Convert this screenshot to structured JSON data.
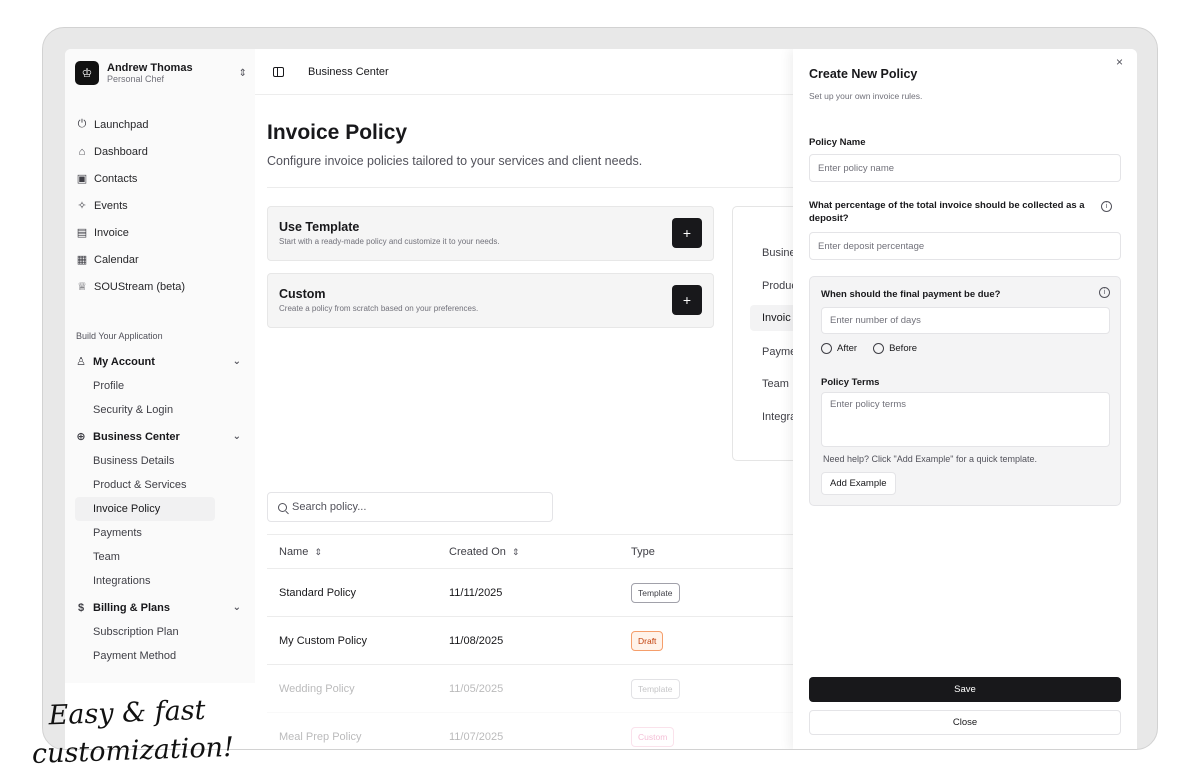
{
  "profile": {
    "name": "Andrew Thomas",
    "role": "Personal Chef",
    "avatar_icon": "chef-hat-icon"
  },
  "nav": [
    {
      "label": "Launchpad",
      "icon": "⏻"
    },
    {
      "label": "Dashboard",
      "icon": "⌂"
    },
    {
      "label": "Contacts",
      "icon": "▣"
    },
    {
      "label": "Events",
      "icon": "✧"
    },
    {
      "label": "Invoice",
      "icon": "▤"
    },
    {
      "label": "Calendar",
      "icon": "▦"
    },
    {
      "label": "SOUStream (beta)",
      "icon": "♕"
    }
  ],
  "section_label": "Build Your Application",
  "groups": {
    "my_account": {
      "label": "My Account",
      "items": [
        "Profile",
        "Security & Login"
      ]
    },
    "business_center": {
      "label": "Business Center",
      "items": [
        "Business Details",
        "Product & Services",
        "Invoice Policy",
        "Payments",
        "Team",
        "Integrations"
      ]
    },
    "billing": {
      "label": "Billing & Plans",
      "items": [
        "Subscription Plan",
        "Payment Method"
      ]
    }
  },
  "topbar": {
    "breadcrumb": "Business Center"
  },
  "page": {
    "title": "Invoice Policy",
    "subtitle": "Configure invoice policies tailored to your services and client needs."
  },
  "cards": {
    "template": {
      "title": "Use Template",
      "desc": "Start with a ready-made policy and customize it to your needs.",
      "btn": "+"
    },
    "custom": {
      "title": "Custom",
      "desc": "Create a policy from scratch based on your preferences.",
      "btn": "+"
    }
  },
  "tabs": [
    "Busine",
    "Produc",
    "Invoic",
    "Payme",
    "Team",
    "Integra"
  ],
  "search": {
    "placeholder": "Search policy..."
  },
  "table": {
    "headers": {
      "name": "Name",
      "created": "Created On",
      "type": "Type"
    },
    "rows": [
      {
        "name": "Standard Policy",
        "created": "11/11/2025",
        "type": "Template"
      },
      {
        "name": "My Custom Policy",
        "created": "11/08/2025",
        "type": "Draft"
      },
      {
        "name": "Wedding Policy",
        "created": "11/05/2025",
        "type": "Template"
      },
      {
        "name": "Meal Prep Policy",
        "created": "11/07/2025",
        "type": "Custom"
      }
    ]
  },
  "drawer": {
    "title": "Create New Policy",
    "subtitle": "Set up your own invoice rules.",
    "close_glyph": "×",
    "policy_name_label": "Policy Name",
    "policy_name_placeholder": "Enter policy name",
    "deposit_label": "What percentage of the total invoice should be collected as a deposit?",
    "deposit_placeholder": "Enter deposit percentage",
    "final_label": "When should the final payment be due?",
    "days_placeholder": "Enter number of days",
    "after_label": "After",
    "before_label": "Before",
    "terms_label": "Policy Terms",
    "terms_placeholder": "Enter policy terms",
    "help_text": "Need help? Click \"Add Example\" for a quick template.",
    "add_example": "Add Example",
    "save": "Save",
    "close": "Close"
  },
  "tagline": {
    "line1": "Easy & fast",
    "line2": "customization!"
  }
}
